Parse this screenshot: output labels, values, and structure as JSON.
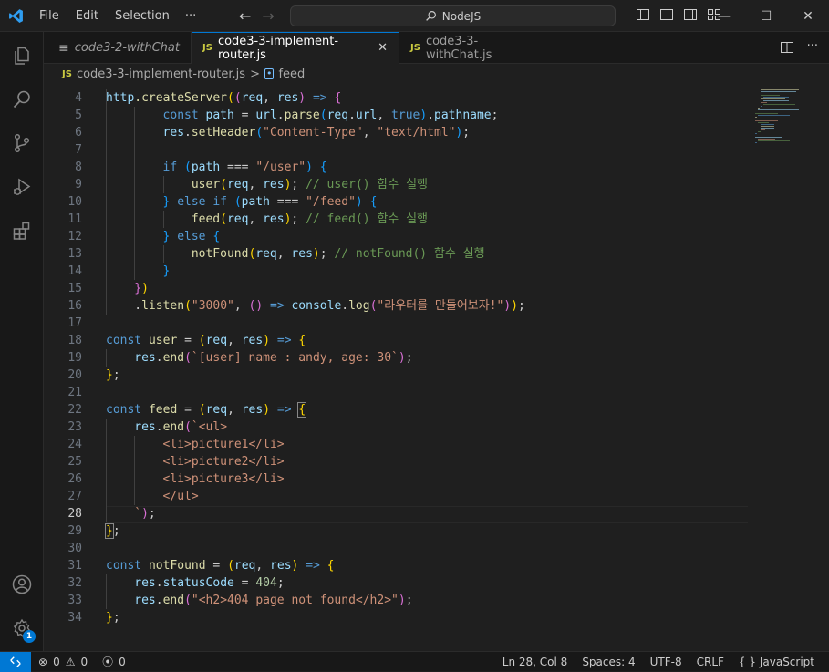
{
  "titlebar": {
    "menu": [
      "File",
      "Edit",
      "Selection"
    ],
    "more": "···",
    "search": "NodeJS"
  },
  "tabs": [
    {
      "label": "code3-2-withChat",
      "italic": true,
      "active": false
    },
    {
      "label": "code3-3-implement-router.js",
      "active": true
    },
    {
      "label": "code3-3-withChat.js",
      "active": false
    }
  ],
  "tab_js_badge": "JS",
  "breadcrumb": {
    "file": "code3-3-implement-router.js",
    "separator": ">",
    "symbol": "feed"
  },
  "editor": {
    "current_line": 28,
    "lines": [
      {
        "n": 4,
        "indent": 1,
        "html": "<span class=\"fn\">.createServer</span><span class=\"p1\">(</span><span class=\"p2\">(</span><span class=\"vr\">req</span>, <span class=\"vr\">res</span><span class=\"p2\">)</span> <span class=\"kw\">=&gt;</span> <span class=\"p2\">{</span>"
      },
      {
        "n": 5,
        "indent": 2,
        "html": "<span class=\"kw\">const</span> <span class=\"vr\">path</span> = <span class=\"vr\">url</span>.<span class=\"fn\">parse</span><span class=\"p3\">(</span><span class=\"vr\">req</span>.<span class=\"vr\">url</span>, <span class=\"kw\">true</span><span class=\"p3\">)</span>.<span class=\"vr\">pathname</span>;"
      },
      {
        "n": 6,
        "indent": 2,
        "html": "<span class=\"vr\">res</span>.<span class=\"fn\">setHeader</span><span class=\"p3\">(</span><span class=\"st\">\"Content-Type\"</span>, <span class=\"st\">\"text/html\"</span><span class=\"p3\">)</span>;"
      },
      {
        "n": 7,
        "indent": 2,
        "html": ""
      },
      {
        "n": 8,
        "indent": 2,
        "html": "<span class=\"kw\">if</span> <span class=\"p3\">(</span><span class=\"vr\">path</span> === <span class=\"st\">\"/user\"</span><span class=\"p3\">)</span> <span class=\"p3\">{</span>"
      },
      {
        "n": 9,
        "indent": 3,
        "html": "<span class=\"fn\">user</span><span class=\"p1\">(</span><span class=\"vr\">req</span>, <span class=\"vr\">res</span><span class=\"p1\">)</span>; <span class=\"cm\">// user() 함수 실행</span>"
      },
      {
        "n": 10,
        "indent": 2,
        "html": "<span class=\"p3\">}</span> <span class=\"kw\">else if</span> <span class=\"p3\">(</span><span class=\"vr\">path</span> === <span class=\"st\">\"/feed\"</span><span class=\"p3\">)</span> <span class=\"p3\">{</span>"
      },
      {
        "n": 11,
        "indent": 3,
        "html": "<span class=\"fn\">feed</span><span class=\"p1\">(</span><span class=\"vr\">req</span>, <span class=\"vr\">res</span><span class=\"p1\">)</span>; <span class=\"cm\">// feed() 함수 실행</span>"
      },
      {
        "n": 12,
        "indent": 2,
        "html": "<span class=\"p3\">}</span> <span class=\"kw\">else</span> <span class=\"p3\">{</span>"
      },
      {
        "n": 13,
        "indent": 3,
        "html": "<span class=\"fn\">notFound</span><span class=\"p1\">(</span><span class=\"vr\">req</span>, <span class=\"vr\">res</span><span class=\"p1\">)</span>; <span class=\"cm\">// notFound() 함수 실행</span>"
      },
      {
        "n": 14,
        "indent": 2,
        "html": "<span class=\"p3\">}</span>"
      },
      {
        "n": 15,
        "indent": 1,
        "html": "<span class=\"p2\">}</span><span class=\"p1\">)</span>"
      },
      {
        "n": 16,
        "indent": 1,
        "html": ".<span class=\"fn\">listen</span><span class=\"p1\">(</span><span class=\"st\">\"3000\"</span>, <span class=\"p2\">()</span> <span class=\"kw\">=&gt;</span> <span class=\"vr\">console</span>.<span class=\"fn\">log</span><span class=\"p2\">(</span><span class=\"st\">\"라우터를 만들어보자!\"</span><span class=\"p2\">)</span><span class=\"p1\">)</span>;"
      },
      {
        "n": 17,
        "indent": 0,
        "html": ""
      },
      {
        "n": 18,
        "indent": 0,
        "html": "<span class=\"kw\">const</span> <span class=\"fn\">user</span> = <span class=\"p1\">(</span><span class=\"vr\">req</span>, <span class=\"vr\">res</span><span class=\"p1\">)</span> <span class=\"kw\">=&gt;</span> <span class=\"p1\">{</span>"
      },
      {
        "n": 19,
        "indent": 1,
        "html": "<span class=\"vr\">res</span>.<span class=\"fn\">end</span><span class=\"p2\">(</span><span class=\"st\">`[user] name : andy, age: 30`</span><span class=\"p2\">)</span>;"
      },
      {
        "n": 20,
        "indent": 0,
        "html": "<span class=\"p1\">}</span>;"
      },
      {
        "n": 21,
        "indent": 0,
        "html": ""
      },
      {
        "n": 22,
        "indent": 0,
        "html": "<span class=\"kw\">const</span> <span class=\"fn\">feed</span> = <span class=\"p1\">(</span><span class=\"vr\">req</span>, <span class=\"vr\">res</span><span class=\"p1\">)</span> <span class=\"kw\">=&gt;</span> <span class=\"p1 bm\">{</span>"
      },
      {
        "n": 23,
        "indent": 1,
        "html": "<span class=\"vr\">res</span>.<span class=\"fn\">end</span><span class=\"p2\">(</span><span class=\"st\">`&lt;ul&gt;</span>"
      },
      {
        "n": 24,
        "indent": 2,
        "html": "<span class=\"st\">&lt;li&gt;picture1&lt;/li&gt;</span>"
      },
      {
        "n": 25,
        "indent": 2,
        "html": "<span class=\"st\">&lt;li&gt;picture2&lt;/li&gt;</span>"
      },
      {
        "n": 26,
        "indent": 2,
        "html": "<span class=\"st\">&lt;li&gt;picture3&lt;/li&gt;</span>"
      },
      {
        "n": 27,
        "indent": 2,
        "html": "<span class=\"st\">&lt;/ul&gt;</span>"
      },
      {
        "n": 28,
        "indent": 1,
        "html": "<span class=\"st\">`</span><span class=\"p2\">)</span>;"
      },
      {
        "n": 29,
        "indent": 0,
        "html": "<span class=\"p1 bm\">}</span>;"
      },
      {
        "n": 30,
        "indent": 0,
        "html": ""
      },
      {
        "n": 31,
        "indent": 0,
        "html": "<span class=\"kw\">const</span> <span class=\"fn\">notFound</span> = <span class=\"p1\">(</span><span class=\"vr\">req</span>, <span class=\"vr\">res</span><span class=\"p1\">)</span> <span class=\"kw\">=&gt;</span> <span class=\"p1\">{</span>"
      },
      {
        "n": 32,
        "indent": 1,
        "html": "<span class=\"vr\">res</span>.<span class=\"vr\">statusCode</span> = <span class=\"nm\">404</span>;"
      },
      {
        "n": 33,
        "indent": 1,
        "html": "<span class=\"vr\">res</span>.<span class=\"fn\">end</span><span class=\"p2\">(</span><span class=\"st\">\"&lt;h2&gt;404 page not found&lt;/h2&gt;\"</span><span class=\"p2\">)</span>;"
      },
      {
        "n": 34,
        "indent": 0,
        "html": "<span class=\"p1\">}</span>;"
      }
    ]
  },
  "statusbar": {
    "errors": "0",
    "warnings": "0",
    "ports": "0",
    "position": "Ln 28, Col 8",
    "spaces": "Spaces: 4",
    "encoding": "UTF-8",
    "eol": "CRLF",
    "language_icon": "{ }",
    "language": "JavaScript"
  },
  "accounts_badge": "1",
  "colors": {
    "accent": "#0078d4",
    "js_badge": "#cbcb41"
  }
}
